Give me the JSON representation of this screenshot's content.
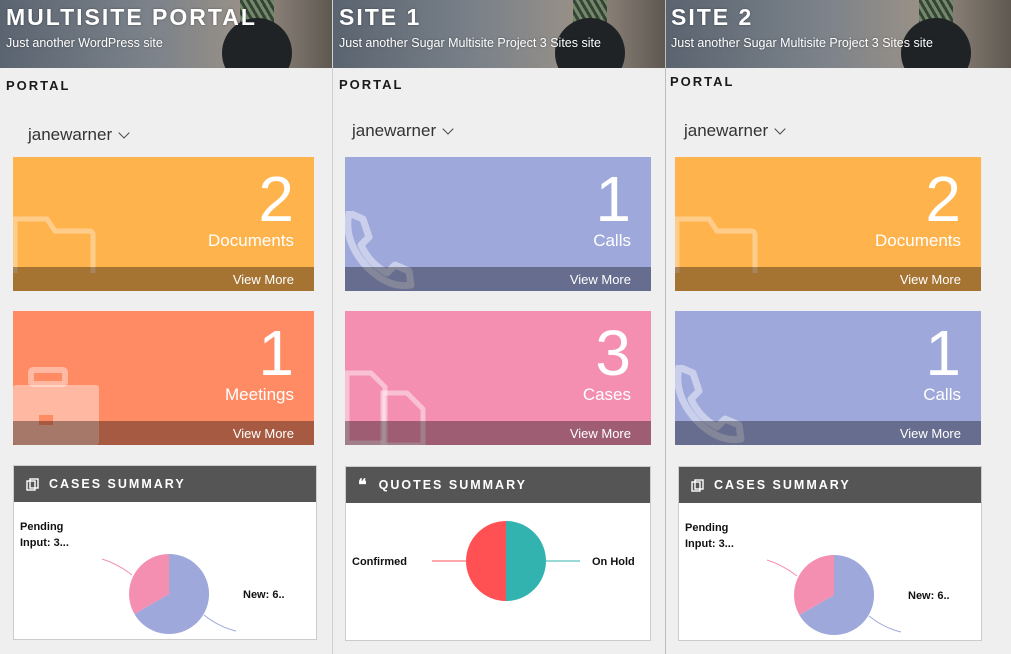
{
  "columns": [
    {
      "site_title": "MULTISITE PORTAL",
      "tagline": "Just another WordPress site",
      "portal_label": "PORTAL",
      "username": "janewarner",
      "tiles": [
        {
          "count": "2",
          "label": "Documents",
          "link": "View More",
          "color": "#ffb34d",
          "icon": "folder-icon"
        },
        {
          "count": "1",
          "label": "Meetings",
          "link": "View More",
          "color": "#ff8b64",
          "icon": "briefcase-icon"
        }
      ],
      "summary": {
        "title": "CASES SUMMARY",
        "icon": "copy-icon",
        "chart_data": {
          "type": "pie",
          "slices": [
            {
              "label": "New: 6..",
              "value": 66.7,
              "color": "#9ea8db"
            },
            {
              "label": "Pending Input: 3...",
              "value": 33.3,
              "color": "#f48fb1"
            }
          ]
        }
      }
    },
    {
      "site_title": "SITE 1",
      "tagline": "Just another Sugar Multisite Project 3 Sites site",
      "portal_label": "PORTAL",
      "username": "janewarner",
      "tiles": [
        {
          "count": "1",
          "label": "Calls",
          "link": "View More",
          "color": "#9ea8db",
          "icon": "phone-icon"
        },
        {
          "count": "3",
          "label": "Cases",
          "link": "View More",
          "color": "#f48fb1",
          "icon": "files-icon"
        }
      ],
      "summary": {
        "title": "QUOTES SUMMARY",
        "icon": "quote-icon",
        "chart_data": {
          "type": "pie",
          "slices": [
            {
              "label": "On Hold",
              "value": 50,
              "color": "#33b3b0"
            },
            {
              "label": "Confirmed",
              "value": 50,
              "color": "#ff5154"
            }
          ]
        }
      }
    },
    {
      "site_title": "SITE 2",
      "tagline": "Just another Sugar Multisite Project 3 Sites site",
      "portal_label": "PORTAL",
      "username": "janewarner",
      "tiles": [
        {
          "count": "2",
          "label": "Documents",
          "link": "View More",
          "color": "#ffb34d",
          "icon": "folder-icon"
        },
        {
          "count": "1",
          "label": "Calls",
          "link": "View More",
          "color": "#9ea8db",
          "icon": "phone-icon"
        }
      ],
      "summary": {
        "title": "CASES SUMMARY",
        "icon": "copy-icon",
        "chart_data": {
          "type": "pie",
          "slices": [
            {
              "label": "New: 6..",
              "value": 66.7,
              "color": "#9ea8db"
            },
            {
              "label": "Pending Input: 3...",
              "value": 33.3,
              "color": "#f48fb1"
            }
          ]
        }
      }
    }
  ]
}
